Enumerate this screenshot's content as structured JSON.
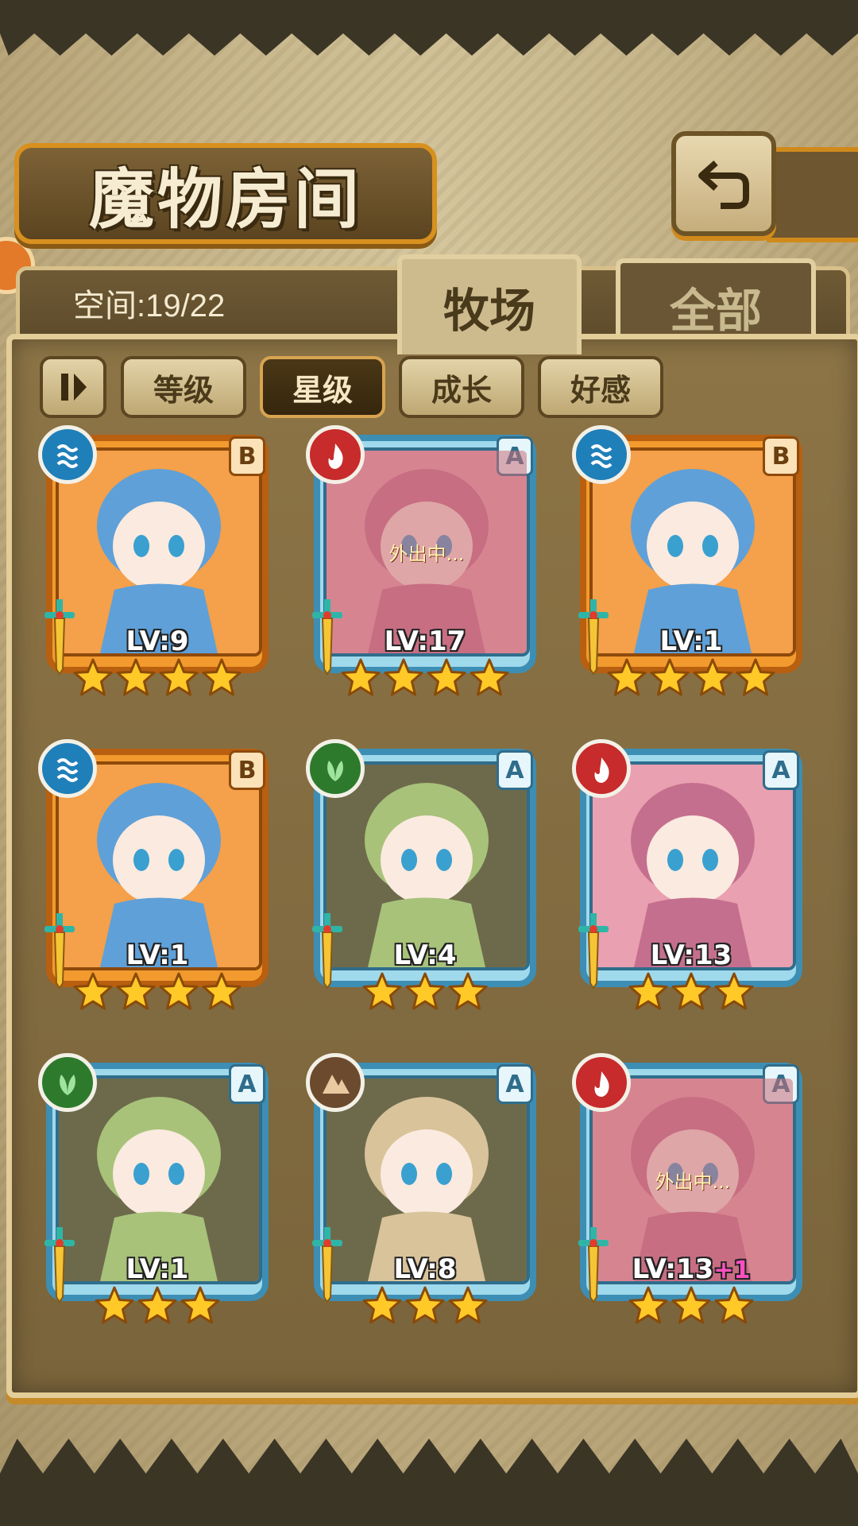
{
  "title": "魔物房间",
  "space": "空间:19/22",
  "tabs": {
    "pasture": "牧场",
    "all": "全部"
  },
  "sort": {
    "options": [
      "等级",
      "星级",
      "成长",
      "好感"
    ],
    "active": "星级"
  },
  "monsters": [
    {
      "rank": "B",
      "element": "water",
      "level": "LV:9",
      "stars": 4,
      "status": ""
    },
    {
      "rank": "A",
      "element": "fire",
      "level": "LV:17",
      "stars": 4,
      "status": "外出中..."
    },
    {
      "rank": "B",
      "element": "water",
      "level": "LV:1",
      "stars": 4,
      "status": ""
    },
    {
      "rank": "B",
      "element": "water",
      "level": "LV:1",
      "stars": 4,
      "status": ""
    },
    {
      "rank": "A",
      "element": "wood",
      "level": "LV:4",
      "stars": 3,
      "status": ""
    },
    {
      "rank": "A",
      "element": "fire",
      "level": "LV:13",
      "stars": 3,
      "status": ""
    },
    {
      "rank": "A",
      "element": "wood",
      "level": "LV:1",
      "stars": 3,
      "status": ""
    },
    {
      "rank": "A",
      "element": "earth",
      "level": "LV:8",
      "stars": 3,
      "status": ""
    },
    {
      "rank": "A",
      "element": "fire",
      "level": "LV:13",
      "level_bonus": "+1",
      "stars": 3,
      "status": "外出中..."
    }
  ],
  "colors": {
    "rank_b_frame": "#f29a2e",
    "rank_a_frame": "#9fd9ec",
    "water": "#1f7fb9",
    "fire": "#c72b2b",
    "wood": "#2d7a2d",
    "earth": "#6c4a2e",
    "star": "#ffc928"
  }
}
